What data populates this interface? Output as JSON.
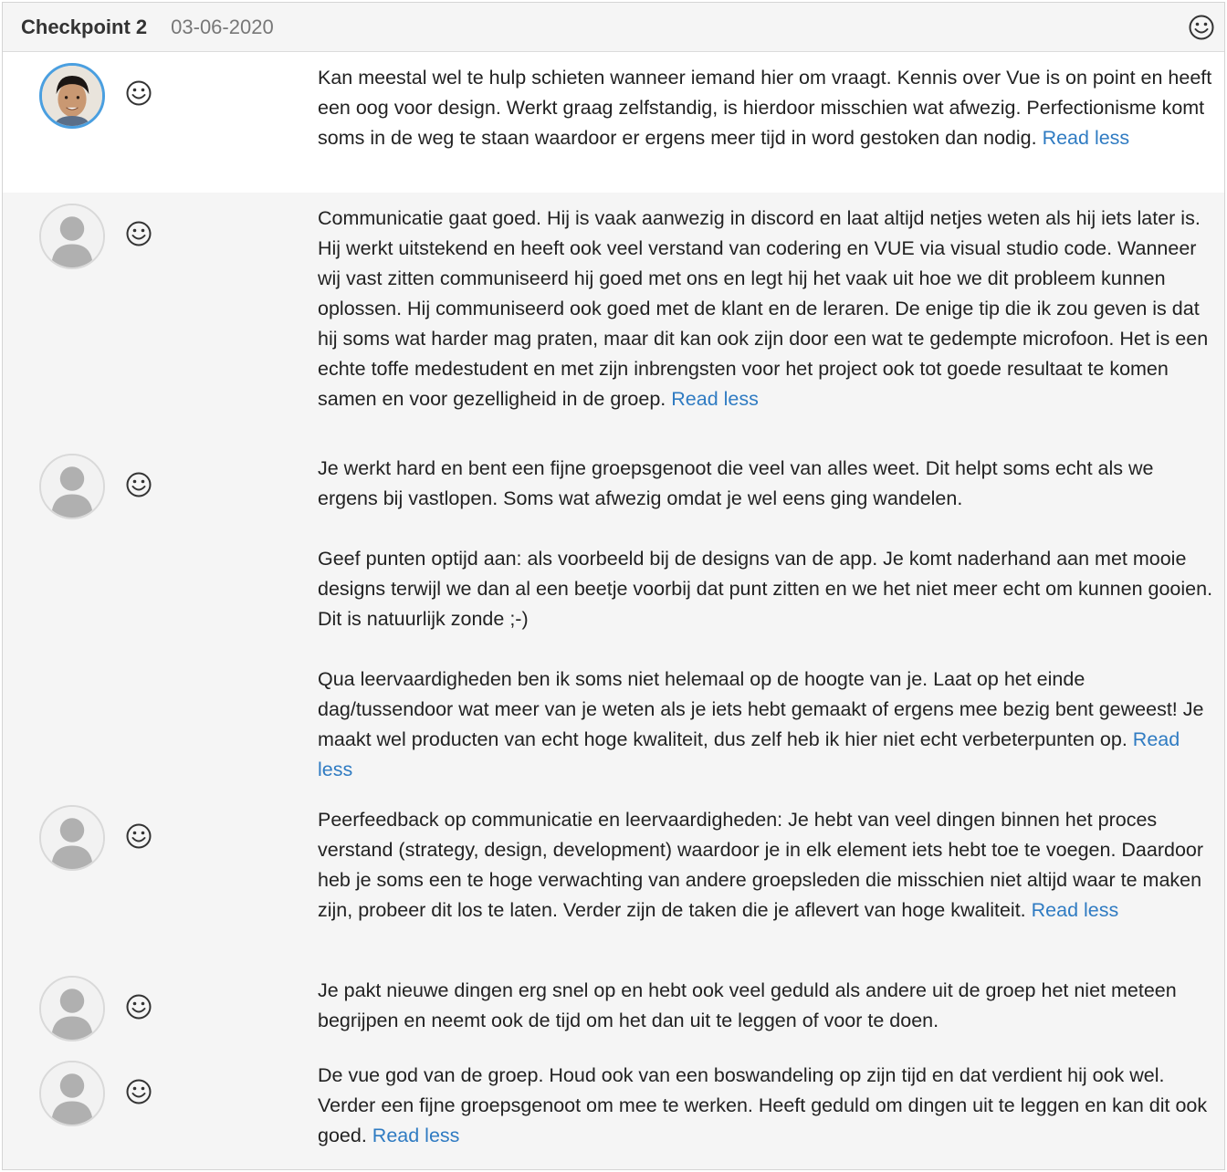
{
  "header": {
    "title": "Checkpoint 2",
    "date": "03-06-2020",
    "mood_icon": "smiley-icon"
  },
  "read_less_label": "Read less",
  "entries": [
    {
      "avatar": "user-photo",
      "mood_icon": "smiley-icon",
      "paragraphs": [
        "Kan meestal wel te hulp schieten wanneer iemand hier om vraagt. Kennis over Vue is on point en heeft een oog voor design. Werkt graag zelfstandig, is hierdoor misschien wat afwezig. Perfectionisme komt soms in de weg te staan waardoor er ergens meer tijd in word gestoken dan nodig."
      ]
    },
    {
      "avatar": "default-avatar",
      "mood_icon": "smiley-icon",
      "paragraphs": [
        "Communicatie gaat goed. Hij is vaak aanwezig in discord en laat altijd netjes weten als hij iets later is. Hij werkt uitstekend en heeft ook veel verstand van codering en VUE via visual studio code. Wanneer wij vast zitten communiseerd hij goed met ons en legt hij het vaak uit hoe we dit probleem kunnen oplossen. Hij communiseerd ook goed met de klant en de leraren. De enige tip die ik zou geven is dat hij soms wat harder mag praten, maar dit kan ook zijn door een wat te gedempte microfoon. Het is een echte toffe medestudent en met zijn inbrengsten voor het project ook tot goede resultaat te komen samen en voor gezelligheid in de groep."
      ]
    },
    {
      "avatar": "default-avatar",
      "mood_icon": "smiley-icon",
      "paragraphs": [
        "Je werkt hard en bent een fijne groepsgenoot die veel van alles weet. Dit helpt soms echt als we ergens bij vastlopen. Soms wat afwezig omdat je wel eens ging wandelen.",
        "Geef punten optijd aan: als voorbeeld bij de designs van de app. Je komt naderhand aan met mooie designs terwijl we dan al een beetje voorbij dat punt zitten en we het niet meer echt om kunnen gooien. Dit is natuurlijk zonde ;-)",
        "Qua leervaardigheden ben ik soms niet helemaal op de hoogte van je. Laat op het einde dag/tussendoor wat meer van je weten als je iets hebt gemaakt of ergens mee bezig bent geweest! Je maakt wel producten van echt hoge kwaliteit, dus zelf heb ik hier niet echt verbeterpunten op."
      ]
    },
    {
      "avatar": "default-avatar",
      "mood_icon": "smiley-icon",
      "paragraphs": [
        "Peerfeedback op communicatie en leervaardigheden: Je hebt van veel dingen binnen het proces verstand (strategy, design, development) waardoor je in elk element iets hebt toe te voegen. Daardoor heb je soms een te hoge verwachting van andere groepsleden die misschien niet altijd waar te maken zijn, probeer dit los te laten. Verder zijn de taken die je aflevert van hoge kwaliteit."
      ]
    },
    {
      "avatar": "default-avatar",
      "mood_icon": "smiley-icon",
      "paragraphs": [
        "Je pakt nieuwe dingen erg snel op en hebt ook veel geduld als andere uit de groep het niet meteen begrijpen en neemt ook de tijd om het dan uit te leggen of voor te doen."
      ]
    },
    {
      "avatar": "default-avatar",
      "mood_icon": "smiley-icon",
      "paragraphs": [
        "De vue god van de groep. Houd ook van een boswandeling op zijn tijd en dat verdient hij ook wel. Verder een fijne groepsgenoot om mee te werken. Heeft geduld om dingen uit te leggen en kan dit ook goed."
      ]
    }
  ]
}
